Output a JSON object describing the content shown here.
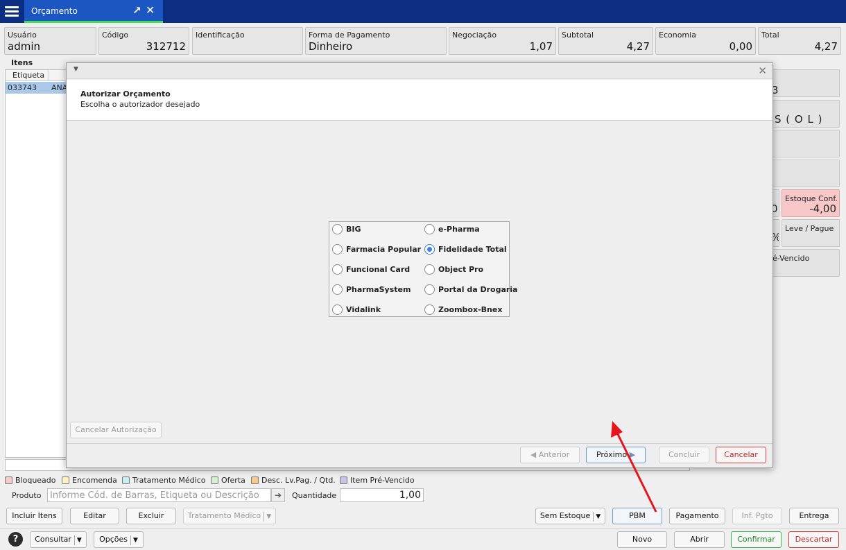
{
  "window": {
    "tab_title": "Orçamento",
    "tab_popout_icon": "↗",
    "tab_close_icon": "✕"
  },
  "header_fields": {
    "usuario": {
      "label": "Usuário",
      "value": "admin"
    },
    "codigo": {
      "label": "Código",
      "value": "312712"
    },
    "identificacao": {
      "label": "Identificação",
      "value": ""
    },
    "forma_pagamento": {
      "label": "Forma de Pagamento",
      "value": "Dinheiro"
    },
    "negociacao": {
      "label": "Negociação",
      "value": "1,07"
    },
    "subtotal": {
      "label": "Subtotal",
      "value": "4,27"
    },
    "economia": {
      "label": "Economia",
      "value": "0,00"
    },
    "total": {
      "label": "Total",
      "value": "4,27"
    }
  },
  "items": {
    "section_label": "Itens",
    "column_etiqueta": "Etiqueta",
    "rows": [
      {
        "etiqueta": "033743",
        "descricao": "ANA"
      }
    ]
  },
  "right_tiles": {
    "t1": "3",
    "t2": "S ( O L )",
    "t5": "0",
    "estoque_conf_label": "Estoque Conf.",
    "estoque_conf_value": "-4,00",
    "t6": "%",
    "leve_pague": "Leve / Pague",
    "pre_vencido": "é-Vencido"
  },
  "legend": [
    {
      "label": "Bloqueado",
      "color": "#f6c9cb"
    },
    {
      "label": "Encomenda",
      "color": "#fbf3c4"
    },
    {
      "label": "Tratamento Médico",
      "color": "#c9eef2"
    },
    {
      "label": "Oferta",
      "color": "#d4f0cf"
    },
    {
      "label": "Desc. Lv.Pag. / Qtd.",
      "color": "#f7c98a"
    },
    {
      "label": "Item Pré-Vencido",
      "color": "#c9c3ec"
    }
  ],
  "product_line": {
    "produto_label": "Produto",
    "produto_placeholder": "Informe Cód. de Barras, Etiqueta ou Descrição",
    "quantidade_label": "Quantidade",
    "quantidade_value": "1,00"
  },
  "action_buttons": {
    "incluir_itens": "Incluir Itens",
    "editar": "Editar",
    "excluir": "Excluir",
    "tratamento_medico": "Tratamento Médico",
    "sem_estoque": "Sem Estoque",
    "pbm": "PBM",
    "pagamento": "Pagamento",
    "inf_pgto": "Inf. Pgto",
    "entrega": "Entrega"
  },
  "bottom_buttons": {
    "help": "?",
    "consultar": "Consultar",
    "opcoes": "Opções",
    "novo": "Novo",
    "abrir": "Abrir",
    "confirmar": "Confirmar",
    "descartar": "Descartar"
  },
  "dialog": {
    "heading": "Autorizar Orçamento",
    "subheading": "Escolha o autorizador desejado",
    "options": [
      {
        "label": "BIG",
        "selected": false
      },
      {
        "label": "e-Pharma",
        "selected": false
      },
      {
        "label": "Farmacia Popular",
        "selected": false
      },
      {
        "label": "Fidelidade Total",
        "selected": true
      },
      {
        "label": "Funcional Card",
        "selected": false
      },
      {
        "label": "Object Pro",
        "selected": false
      },
      {
        "label": "PharmaSystem",
        "selected": false
      },
      {
        "label": "Portal da Drogaria",
        "selected": false
      },
      {
        "label": "Vidalink",
        "selected": false
      },
      {
        "label": "Zoombox-Bnex",
        "selected": false
      }
    ],
    "cancelar_autorizacao": "Cancelar Autorização",
    "anterior": "Anterior",
    "proximo": "Próximo",
    "concluir": "Concluir",
    "cancelar": "Cancelar"
  },
  "colors": {
    "title_bar": "#0b2e83",
    "active_tab": "#1c56c3",
    "tab_underline": "#3fe05e",
    "annotation_arrow": "#e8141c"
  }
}
